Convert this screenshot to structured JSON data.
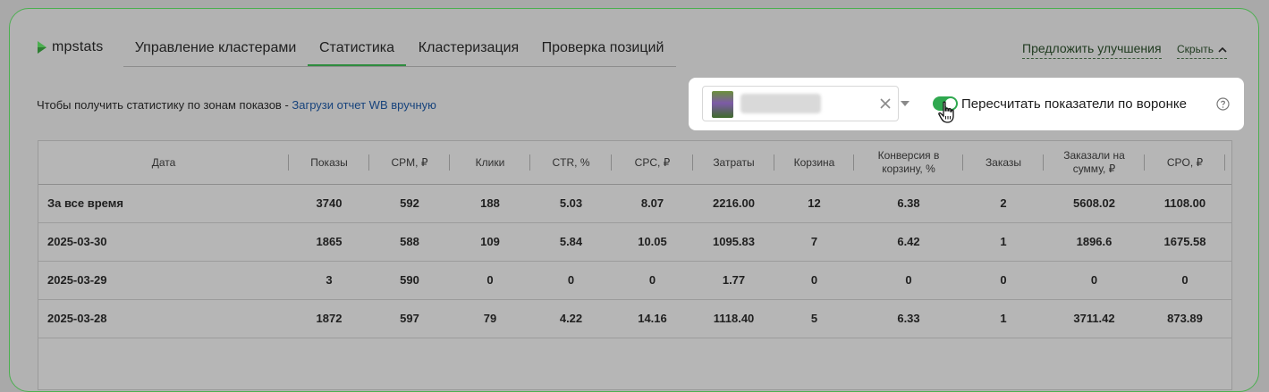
{
  "app": {
    "logo_text": "mpstats"
  },
  "tabs": [
    {
      "label": "Управление кластерами",
      "active": false
    },
    {
      "label": "Статистика",
      "active": true
    },
    {
      "label": "Кластеризация",
      "active": false
    },
    {
      "label": "Проверка позиций",
      "active": false
    }
  ],
  "header": {
    "suggest_label": "Предложить улучшения",
    "hide_label": "Скрыть"
  },
  "hint": {
    "text": "Чтобы получить статистику по зонам показов - ",
    "link": "Загрузи отчет WB вручную"
  },
  "filter": {
    "toggle_on": true,
    "toggle_label": "Пересчитать показатели по воронке"
  },
  "colors": {
    "accent": "#2fa84f",
    "link": "#17437c",
    "border": "#4caf50"
  },
  "table": {
    "columns": [
      "Дата",
      "Показы",
      "CPM, ₽",
      "Клики",
      "CTR, %",
      "CPC, ₽",
      "Затраты",
      "Корзина",
      "Конверсия в корзину, %",
      "Заказы",
      "Заказали на сумму, ₽",
      "CPO, ₽"
    ],
    "rows": [
      [
        "За все время",
        "3740",
        "592",
        "188",
        "5.03",
        "8.07",
        "2216.00",
        "12",
        "6.38",
        "2",
        "5608.02",
        "1108.00"
      ],
      [
        "2025-03-30",
        "1865",
        "588",
        "109",
        "5.84",
        "10.05",
        "1095.83",
        "7",
        "6.42",
        "1",
        "1896.6",
        "1675.58"
      ],
      [
        "2025-03-29",
        "3",
        "590",
        "0",
        "0",
        "0",
        "1.77",
        "0",
        "0",
        "0",
        "0",
        "0"
      ],
      [
        "2025-03-28",
        "1872",
        "597",
        "79",
        "4.22",
        "14.16",
        "1118.40",
        "5",
        "6.33",
        "1",
        "3711.42",
        "873.89"
      ]
    ]
  }
}
